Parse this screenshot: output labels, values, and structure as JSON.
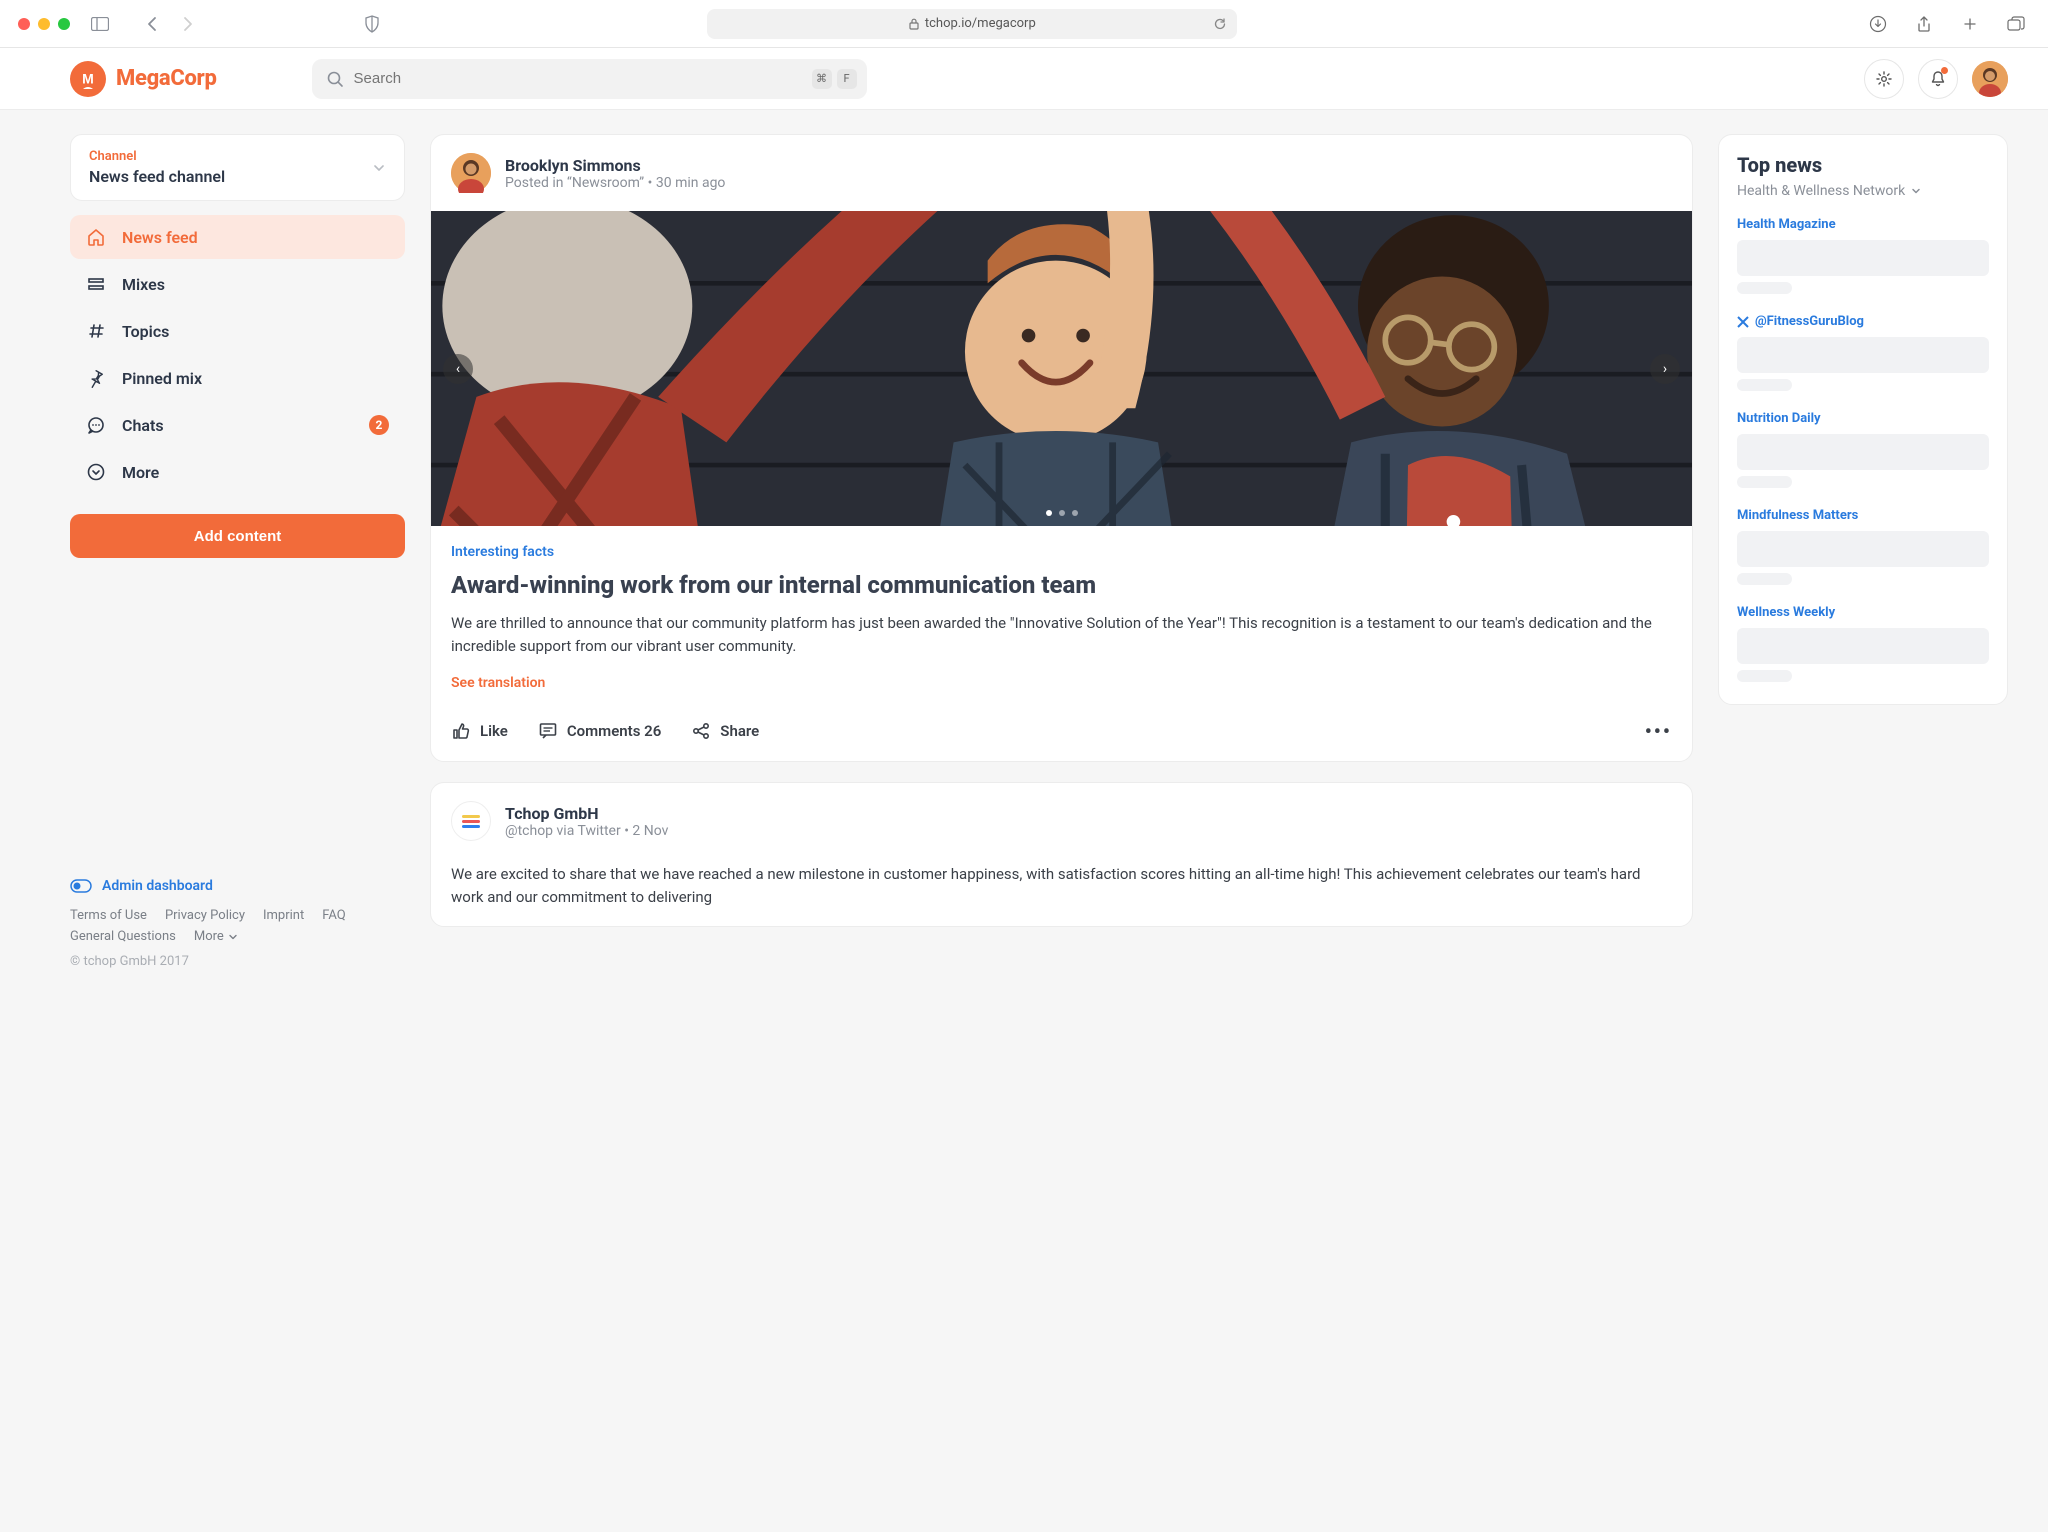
{
  "browser": {
    "url_host_path": "tchop.io/megacorp"
  },
  "app": {
    "brand": "MegaCorp",
    "search_placeholder": "Search",
    "kbd1": "⌘",
    "kbd2": "F"
  },
  "channel": {
    "label": "Channel",
    "value": "News feed channel"
  },
  "nav": {
    "items": [
      {
        "label": "News feed",
        "active": true
      },
      {
        "label": "Mixes"
      },
      {
        "label": "Topics"
      },
      {
        "label": "Pinned mix"
      },
      {
        "label": "Chats",
        "badge": "2"
      },
      {
        "label": "More"
      }
    ],
    "add_button": "Add content"
  },
  "footer": {
    "admin": "Admin dashboard",
    "links": [
      "Terms of Use",
      "Privacy Policy",
      "Imprint",
      "FAQ",
      "General Questions",
      "More"
    ],
    "copyright": "© tchop GmbH 2017"
  },
  "post": {
    "author": "Brooklyn Simmons",
    "meta": "Posted in “Newsroom” • 30 min ago",
    "tag": "Interesting facts",
    "title": "Award-winning work from our internal communication team",
    "body": "We are thrilled to announce that our community platform has just been awarded the \"Innovative Solution of the Year\"! This recognition is a testament to our team's dedication and the incredible support from our vibrant user community.",
    "see_translation": "See translation",
    "like": "Like",
    "comments": "Comments 26",
    "share": "Share"
  },
  "post2": {
    "author": "Tchop GmbH",
    "meta": "@tchop via Twitter • 2 Nov",
    "body": "We are excited to share that we have reached a new milestone in customer happiness, with satisfaction scores hitting an all-time high! This achievement celebrates our team's hard work and our commitment to delivering"
  },
  "topnews": {
    "title": "Top news",
    "subtitle": "Health & Wellness Network",
    "sources": [
      {
        "name": "Health Magazine"
      },
      {
        "name": "@FitnessGuruBlog",
        "twitter": true
      },
      {
        "name": "Nutrition Daily"
      },
      {
        "name": "Mindfulness Matters"
      },
      {
        "name": "Wellness Weekly"
      }
    ]
  }
}
